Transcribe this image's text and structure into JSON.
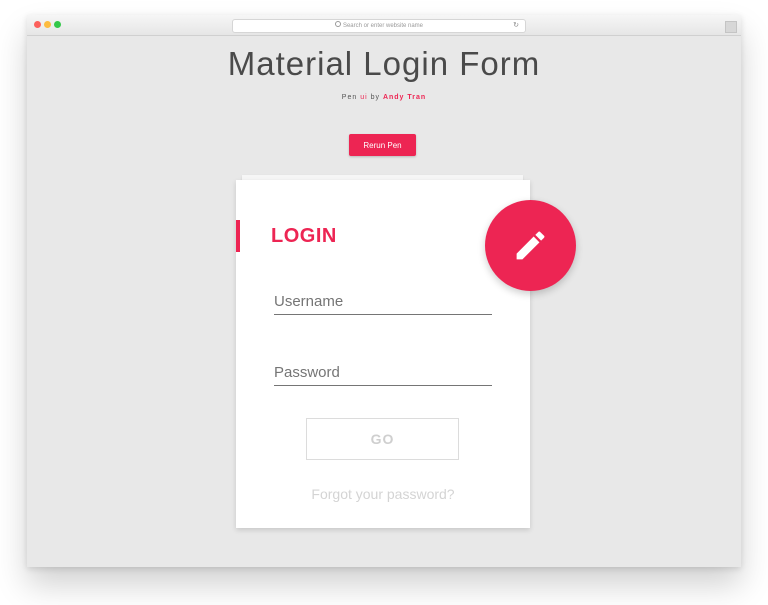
{
  "browser": {
    "address_placeholder": "Search or enter website name",
    "reload_glyph": "↻"
  },
  "page": {
    "title": "Material Login Form",
    "byline": {
      "prefix": "Pen ",
      "ui_word": "ui",
      "by": " by ",
      "author": "Andy Tran"
    },
    "rerun_label": "Rerun Pen"
  },
  "form": {
    "heading": "LOGIN",
    "username_placeholder": "Username",
    "password_placeholder": "Password",
    "submit_label": "GO",
    "forgot_label": "Forgot your password?"
  },
  "colors": {
    "accent": "#ed2553",
    "background": "#e8e8e8",
    "card": "#ffffff"
  },
  "icons": {
    "fab": "pencil-icon",
    "search": "search-icon",
    "reload": "reload-icon"
  }
}
